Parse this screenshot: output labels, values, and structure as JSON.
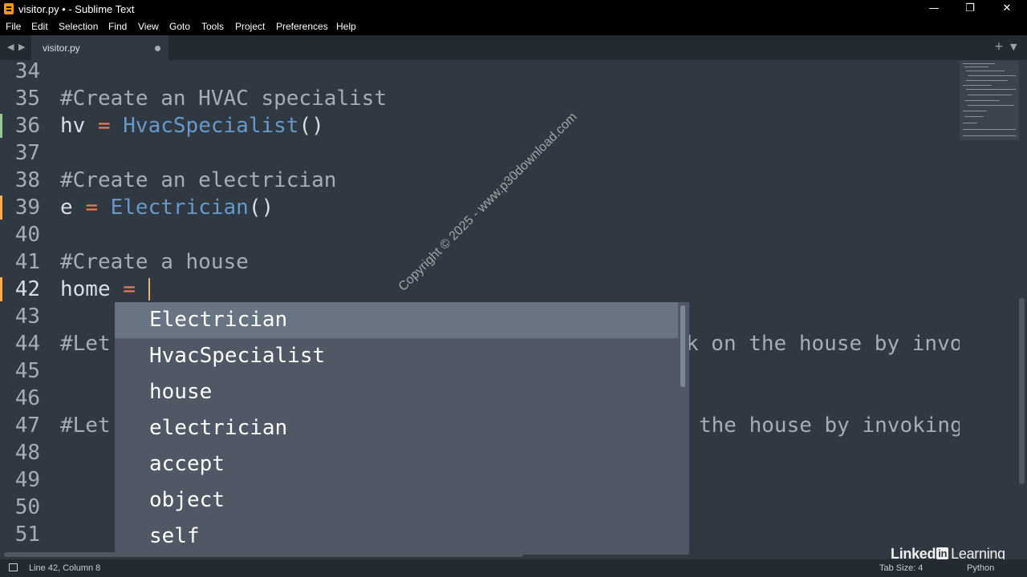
{
  "window": {
    "title": "visitor.py • - Sublime Text",
    "controls": {
      "minimize": "—",
      "restore": "❐",
      "close": "✕"
    }
  },
  "menu": [
    "File",
    "Edit",
    "Selection",
    "Find",
    "View",
    "Goto",
    "Tools",
    "Project",
    "Preferences",
    "Help"
  ],
  "tabs": [
    {
      "label": "visitor.py",
      "modified": true
    }
  ],
  "tab_nav": {
    "back": "◀",
    "forward": "▶",
    "new_tab": "+",
    "tab_menu": "▼"
  },
  "editor": {
    "current_line": 42,
    "lines": [
      {
        "num": "34",
        "text": ""
      },
      {
        "num": "35",
        "text": "#Create an HVAC specialist"
      },
      {
        "num": "36",
        "text": "hv = HvacSpecialist()"
      },
      {
        "num": "37",
        "text": ""
      },
      {
        "num": "38",
        "text": "#Create an electrician"
      },
      {
        "num": "39",
        "text": "e = Electrician()"
      },
      {
        "num": "40",
        "text": ""
      },
      {
        "num": "41",
        "text": "#Create a house"
      },
      {
        "num": "42",
        "text": "home = "
      },
      {
        "num": "43",
        "text": ""
      },
      {
        "num": "44",
        "text": "#Let",
        "tail": "k on the house by invo"
      },
      {
        "num": "45",
        "text": ""
      },
      {
        "num": "46",
        "text": ""
      },
      {
        "num": "47",
        "text": "#Let",
        "tail": "the house by invoking"
      },
      {
        "num": "48",
        "text": ""
      },
      {
        "num": "49",
        "text": ""
      },
      {
        "num": "50",
        "text": ""
      },
      {
        "num": "51",
        "text": ""
      }
    ]
  },
  "autocomplete": {
    "selected_index": 0,
    "items": [
      "Electrician",
      "HvacSpecialist",
      "house",
      "electrician",
      "accept",
      "object",
      "self"
    ]
  },
  "status": {
    "position": "Line 42, Column 8",
    "tab_size": "Tab Size: 4",
    "syntax": "Python"
  },
  "overlays": {
    "watermark": "Copyright © 2025 - www.p30download.com",
    "brand_linked": "Linked",
    "brand_in": "in",
    "brand_learning": "Learning"
  },
  "colors": {
    "background": "#303841",
    "comment": "#a6acb9",
    "operator": "#f97b58",
    "class": "#6699cc",
    "modified_marker": "#f9ae58",
    "added_marker": "#99c794",
    "popup_bg": "#4f5864",
    "popup_selected": "#697482"
  }
}
